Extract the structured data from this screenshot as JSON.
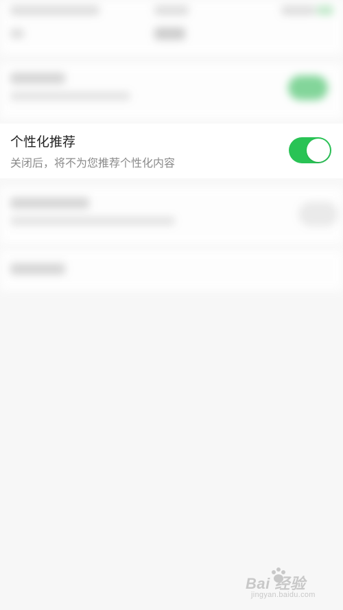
{
  "settings": {
    "personalized_recommendation": {
      "title": "个性化推荐",
      "description": "关闭后，将不为您推荐个性化内容",
      "enabled": true
    }
  },
  "colors": {
    "toggle_on": "#29c355",
    "page_background": "#f7f7f7",
    "title_text": "#222222",
    "subtitle_text": "#8a8a8a"
  },
  "watermark": {
    "brand": "Bai  经验",
    "url": "jingyan.baidu.com"
  }
}
